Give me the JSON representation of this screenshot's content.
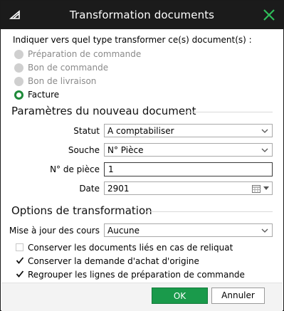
{
  "window": {
    "title": "Transformation documents"
  },
  "prompt": "Indiquer vers quel type transformer ce(s) document(s) :",
  "doc_types": [
    {
      "label": "Préparation de commande",
      "selected": false
    },
    {
      "label": "Bon de commande",
      "selected": false
    },
    {
      "label": "Bon de livraison",
      "selected": false
    },
    {
      "label": "Facture",
      "selected": true
    }
  ],
  "new_doc": {
    "section_title": "Paramètres du nouveau document",
    "statut_label": "Statut",
    "statut_value": "A comptabiliser",
    "souche_label": "Souche",
    "souche_value": "N° Pièce",
    "piece_label": "N° de pièce",
    "piece_value": "1",
    "date_label": "Date",
    "date_value": "2901"
  },
  "options": {
    "section_title": "Options de transformation",
    "cours_label": "Mise à jour des cours",
    "cours_value": "Aucune",
    "checks": [
      {
        "label": "Conserver les documents liés en cas de reliquat",
        "checked": false
      },
      {
        "label": "Conserver la demande d'achat d'origine",
        "checked": true
      },
      {
        "label": "Regrouper les lignes de préparation de commande",
        "checked": true
      }
    ]
  },
  "buttons": {
    "ok": "OK",
    "cancel": "Annuler"
  },
  "colors": {
    "accent": "#1a9a4b",
    "titlebar": "#1b1b1b"
  }
}
